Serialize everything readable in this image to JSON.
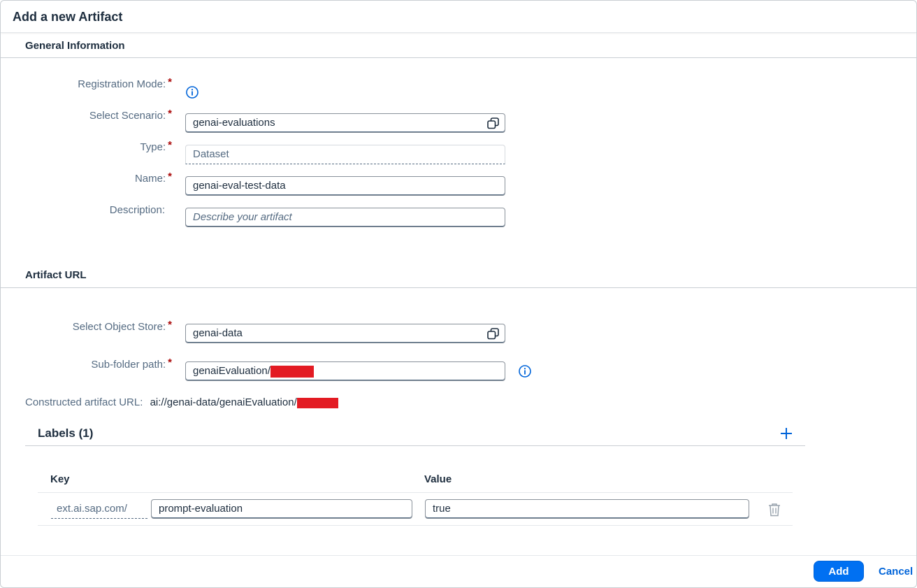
{
  "dialog": {
    "title": "Add a new Artifact"
  },
  "general": {
    "section_title": "General Information",
    "registration_mode_label": "Registration Mode:",
    "scenario_label": "Select Scenario:",
    "scenario_value": "genai-evaluations",
    "type_label": "Type:",
    "type_value": "Dataset",
    "name_label": "Name:",
    "name_value": "genai-eval-test-data",
    "description_label": "Description:",
    "description_placeholder": "Describe your artifact",
    "required_mark": "*"
  },
  "artifact_url": {
    "section_title": "Artifact URL",
    "object_store_label": "Select Object Store:",
    "object_store_value": "genai-data",
    "subfolder_label": "Sub-folder path:",
    "subfolder_value": "genaiEvaluation/",
    "constructed_label": "Constructed artifact URL:",
    "constructed_value": "ai://genai-data/genaiEvaluation/"
  },
  "labels": {
    "title": "Labels (1)",
    "columns": {
      "key": "Key",
      "value": "Value"
    },
    "rows": [
      {
        "prefix": "ext.ai.sap.com/",
        "key": "prompt-evaluation",
        "value": "true"
      }
    ]
  },
  "footer": {
    "add_label": "Add",
    "cancel_label": "Cancel"
  },
  "icons": {
    "info": "info-icon",
    "value_help": "value-help-icon",
    "add": "plus-icon",
    "delete": "trash-icon"
  },
  "colors": {
    "accent": "#0070f2",
    "required": "#aa0808",
    "label_text": "#556b82",
    "redaction": "#e31b23"
  }
}
